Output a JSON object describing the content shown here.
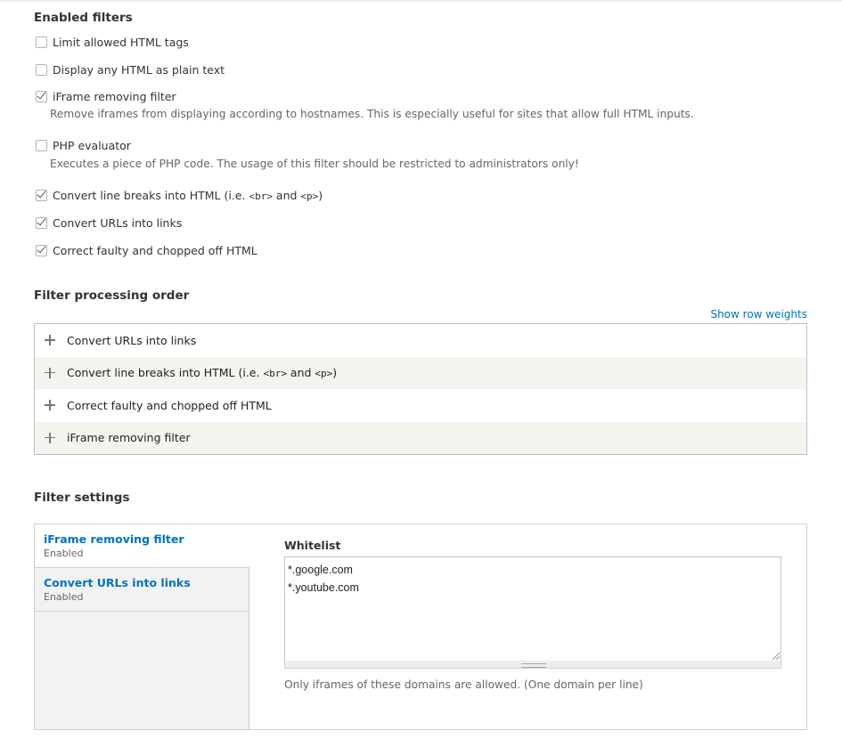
{
  "enabled_filters": {
    "heading": "Enabled filters",
    "items": [
      {
        "label": "Limit allowed HTML tags",
        "checked": false
      },
      {
        "label": "Display any HTML as plain text",
        "checked": false
      },
      {
        "label": "iFrame removing filter",
        "checked": true,
        "description": "Remove iframes from displaying according to hostnames. This is especially useful for sites that allow full HTML inputs."
      },
      {
        "label": "PHP evaluator",
        "checked": false,
        "description": "Executes a piece of PHP code. The usage of this filter should be restricted to administrators only!"
      },
      {
        "label_parts": [
          "Convert line breaks into HTML (i.e. ",
          "<br>",
          " and ",
          "<p>",
          ")"
        ],
        "checked": true
      },
      {
        "label": "Convert URLs into links",
        "checked": true
      },
      {
        "label": "Correct faulty and chopped off HTML",
        "checked": true
      }
    ]
  },
  "processing_order": {
    "heading": "Filter processing order",
    "show_row_weights": "Show row weights",
    "rows": [
      {
        "label": "Convert URLs into links"
      },
      {
        "label_parts": [
          "Convert line breaks into HTML (i.e. ",
          "<br>",
          " and ",
          "<p>",
          ")"
        ]
      },
      {
        "label": "Correct faulty and chopped off HTML"
      },
      {
        "label": "iFrame removing filter"
      }
    ]
  },
  "filter_settings": {
    "heading": "Filter settings",
    "tabs": [
      {
        "title": "iFrame removing filter",
        "summary": "Enabled",
        "active": true
      },
      {
        "title": "Convert URLs into links",
        "summary": "Enabled",
        "active": false
      }
    ],
    "whitelist_label": "Whitelist",
    "whitelist_value": "*.google.com\n*.youtube.com",
    "whitelist_help": "Only iframes of these domains are allowed. (One domain per line)"
  },
  "colors": {
    "link": "#0074bd",
    "row_stripe": "#f3f4ee"
  }
}
